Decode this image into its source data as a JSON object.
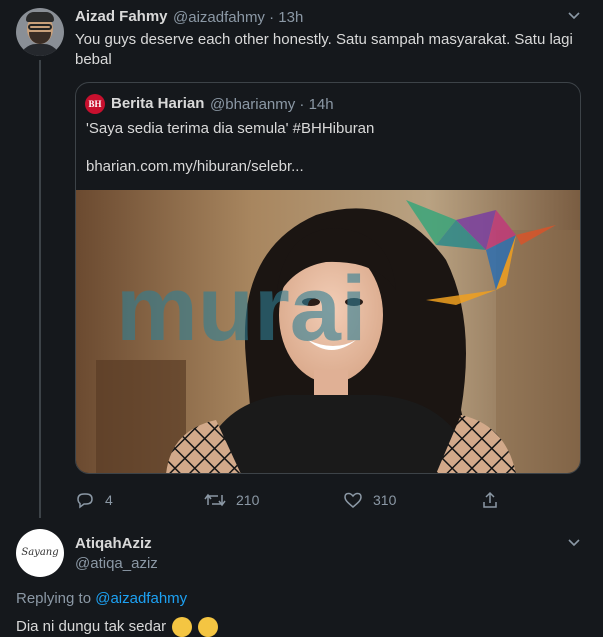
{
  "tweet": {
    "name": "Aizad Fahmy",
    "handle_time": "@aizadfahmy · 13h",
    "text": "You guys deserve each other honestly. Satu sampah masyarakat. Satu lagi bebal",
    "quote": {
      "logo": "BH",
      "name": "Berita Harian",
      "handle_time": "@bharianmy · 14h",
      "text": "'Saya sedia terima dia semula' #BHHiburan",
      "link": "bharian.com.my/hiburan/selebr...",
      "image_watermark": "murai"
    },
    "actions": {
      "replies": "4",
      "retweets": "210",
      "likes": "310"
    }
  },
  "reply": {
    "avatar_text": "Sayang",
    "name": "AtiqahAziz",
    "handle": "@atiqa_aziz",
    "replying_label": "Replying to",
    "replying_to": "@aizadfahmy",
    "text": "Dia ni dungu tak sedar"
  },
  "colors": {
    "background": "#15181c",
    "accent": "#1da1f2",
    "muted": "#8b98a5"
  },
  "icons": [
    "chevron-down-icon",
    "reply-icon",
    "retweet-icon",
    "like-icon",
    "share-icon"
  ]
}
